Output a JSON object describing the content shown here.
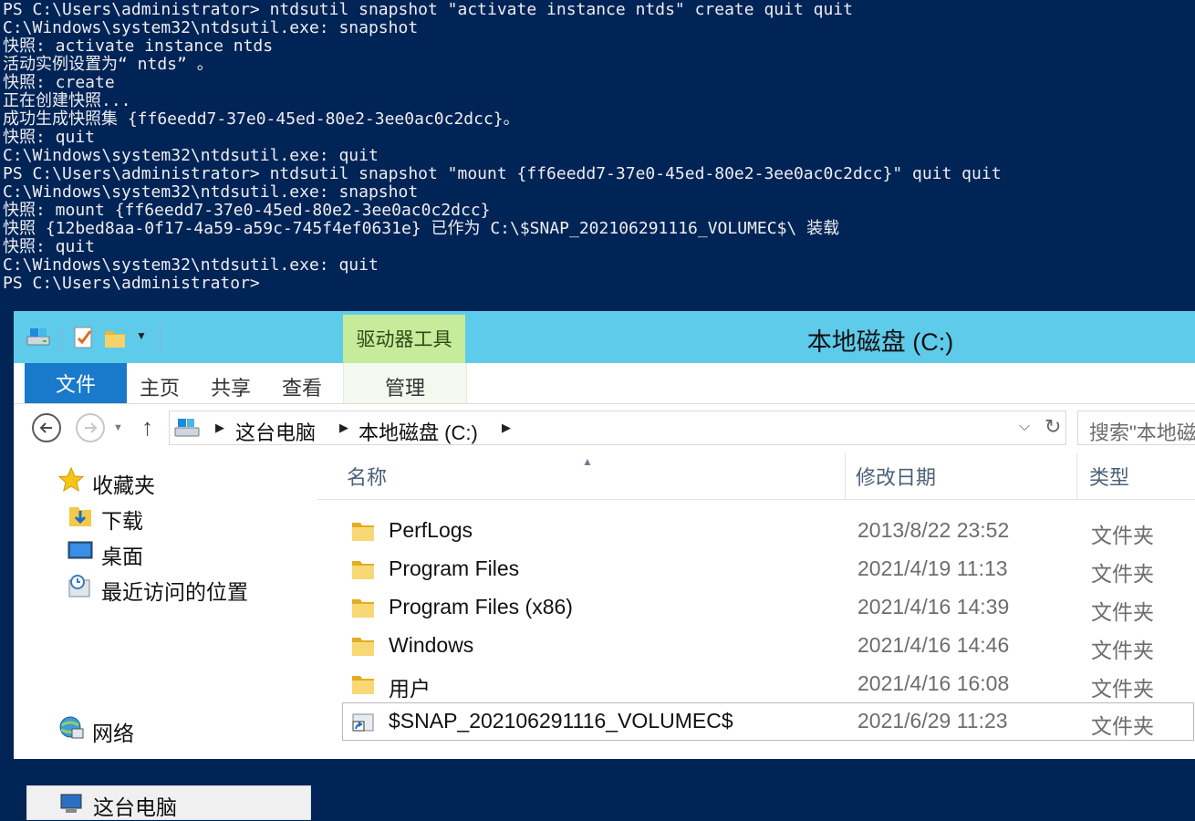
{
  "console": {
    "lines": [
      "PS C:\\Users\\administrator> ntdsutil snapshot \"activate instance ntds\" create quit quit",
      "C:\\Windows\\system32\\ntdsutil.exe: snapshot",
      "快照: activate instance ntds",
      "活动实例设置为“ ntds” 。",
      "快照: create",
      "正在创建快照...",
      "成功生成快照集 {ff6eedd7-37e0-45ed-80e2-3ee0ac0c2dcc}。",
      "快照: quit",
      "C:\\Windows\\system32\\ntdsutil.exe: quit",
      "PS C:\\Users\\administrator> ntdsutil snapshot \"mount {ff6eedd7-37e0-45ed-80e2-3ee0ac0c2dcc}\" quit quit",
      "C:\\Windows\\system32\\ntdsutil.exe: snapshot",
      "快照: mount {ff6eedd7-37e0-45ed-80e2-3ee0ac0c2dcc}",
      "快照 {12bed8aa-0f17-4a59-a59c-745f4ef0631e} 已作为 C:\\$SNAP_202106291116_VOLUMEC$\\ 装载",
      "快照: quit",
      "C:\\Windows\\system32\\ntdsutil.exe: quit",
      "PS C:\\Users\\administrator>"
    ]
  },
  "explorer": {
    "tool_group": "驱动器工具",
    "window_title": "本地磁盘 (C:)",
    "ribbon": {
      "file": "文件",
      "home": "主页",
      "share": "共享",
      "view": "查看",
      "manage": "管理"
    },
    "address": {
      "crumbs": [
        "这台电脑",
        "本地磁盘 (C:)"
      ]
    },
    "search": {
      "placeholder": "搜索\"本地磁盘 (C:)\""
    },
    "nav": {
      "favorites": "收藏夹",
      "downloads": "下载",
      "desktop": "桌面",
      "recent": "最近访问的位置",
      "this_pc": "这台电脑",
      "network": "网络"
    },
    "columns": {
      "name": "名称",
      "date": "修改日期",
      "type": "类型"
    },
    "files": [
      {
        "name": "PerfLogs",
        "date": "2013/8/22 23:52",
        "type": "文件夹"
      },
      {
        "name": "Program Files",
        "date": "2021/4/19 11:13",
        "type": "文件夹"
      },
      {
        "name": "Program Files (x86)",
        "date": "2021/4/16 14:39",
        "type": "文件夹"
      },
      {
        "name": "Windows",
        "date": "2021/4/16 14:46",
        "type": "文件夹"
      },
      {
        "name": "用户",
        "date": "2021/4/16 16:08",
        "type": "文件夹"
      },
      {
        "name": "$SNAP_202106291116_VOLUMEC$",
        "date": "2021/6/29 11:23",
        "type": "文件夹"
      }
    ]
  },
  "colors": {
    "console_bg": "#012456",
    "titlebar": "#5ecbeb",
    "tool_group": "#c5eb9b",
    "file_tab": "#1979ca"
  }
}
